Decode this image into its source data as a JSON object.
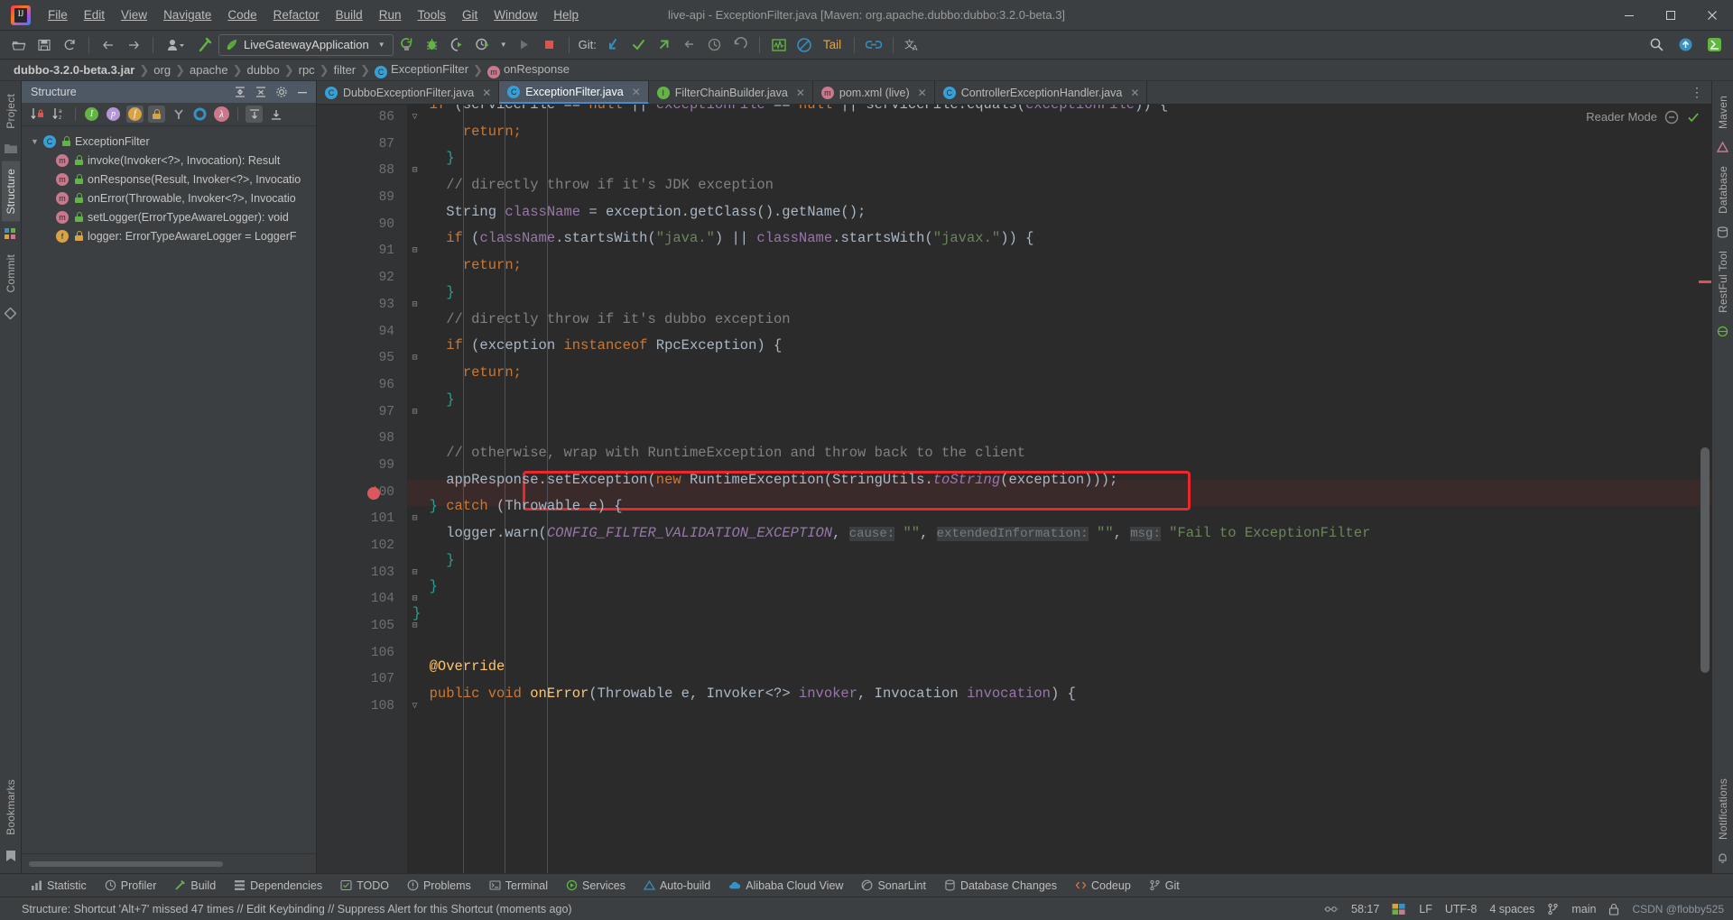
{
  "window": {
    "title": "live-api - ExceptionFilter.java [Maven: org.apache.dubbo:dubbo:3.2.0-beta.3]",
    "minimize": "—",
    "maximize": "❐",
    "close": "✕",
    "logo_text": "IJ"
  },
  "menubar": [
    {
      "name": "file",
      "label": "File"
    },
    {
      "name": "edit",
      "label": "Edit"
    },
    {
      "name": "view",
      "label": "View"
    },
    {
      "name": "navigate",
      "label": "Navigate"
    },
    {
      "name": "code",
      "label": "Code"
    },
    {
      "name": "refactor",
      "label": "Refactor"
    },
    {
      "name": "build",
      "label": "Build"
    },
    {
      "name": "run",
      "label": "Run"
    },
    {
      "name": "tools",
      "label": "Tools"
    },
    {
      "name": "git",
      "label": "Git"
    },
    {
      "name": "window",
      "label": "Window"
    },
    {
      "name": "help",
      "label": "Help"
    }
  ],
  "toolbar": {
    "open_icon": "open-folder-icon",
    "save_icon": "save-icon",
    "sync_icon": "refresh-icon",
    "back_icon": "back-arrow-icon",
    "forward_icon": "forward-arrow-icon",
    "profile_icon": "user-profile-icon",
    "build_icon": "hammer-icon",
    "run_config": "LiveGatewayApplication",
    "rerun_icon": "rerun-icon",
    "debug_icon": "debug-bug-icon",
    "coverage_icon": "run-with-coverage-icon",
    "profiler_icon": "profiler-clock-icon",
    "run_icon": "run-play-icon",
    "stop_icon": "stop-icon",
    "git_label": "Git:",
    "git_update": "update-project-icon",
    "git_commit": "commit-check-icon",
    "git_push": "push-arrow-icon",
    "git_revert": "rollback-icon",
    "git_history": "history-clock-icon",
    "undo_icon": "undo-icon",
    "monitor_icon": "monitor-graph-icon",
    "block_icon": "no-entry-icon",
    "tail_label": "Tail",
    "link_icon": "link-icon",
    "translate_icon": "translate-icon",
    "search_icon": "search-icon",
    "updates_icon": "updates-arrow-icon",
    "ide_icon": "ide-icon"
  },
  "breadcrumbs": [
    {
      "label": "dubbo-3.2.0-beta.3.jar",
      "icon": ""
    },
    {
      "label": "org",
      "icon": ""
    },
    {
      "label": "apache",
      "icon": ""
    },
    {
      "label": "dubbo",
      "icon": ""
    },
    {
      "label": "rpc",
      "icon": ""
    },
    {
      "label": "filter",
      "icon": ""
    },
    {
      "label": "ExceptionFilter",
      "icon": "class-icon"
    },
    {
      "label": "onResponse",
      "icon": "method-icon"
    }
  ],
  "left_rail": {
    "project_tab": "Project",
    "structure_tab": "Structure",
    "commit_tab": "Commit",
    "bookmarks_tab": "Bookmarks"
  },
  "right_rail": {
    "maven_tab": "Maven",
    "database_tab": "Database",
    "restful_tab": "RestFul Tool",
    "notifications_tab": "Notifications"
  },
  "structure": {
    "title": "Structure",
    "expand_icon": "expand-all-icon",
    "collapse_icon": "collapse-all-icon",
    "settings_icon": "gear-icon",
    "hide_icon": "hide-icon",
    "more_icon": "more-options-icon",
    "toolbar_icons": [
      "sort-by-visibility-icon",
      "sort-alphabetically-icon",
      "show-inherited-icon",
      "show-properties-icon",
      "show-fields-icon",
      "show-non-public-icon",
      "show-anonymous-icon",
      "show-interfaces-icon",
      "show-lambdas-icon",
      "scroll-from-source-icon",
      "scroll-to-source-icon"
    ],
    "tree": [
      {
        "label": "ExceptionFilter",
        "kind": "class",
        "indent": 0,
        "expanded": true,
        "lock": "green"
      },
      {
        "label": "invoke(Invoker<?>, Invocation): Result",
        "kind": "method",
        "indent": 1,
        "lock": "green"
      },
      {
        "label": "onResponse(Result, Invoker<?>, Invocatio",
        "kind": "method",
        "indent": 1,
        "lock": "green"
      },
      {
        "label": "onError(Throwable, Invoker<?>, Invocatio",
        "kind": "method",
        "indent": 1,
        "lock": "green"
      },
      {
        "label": "setLogger(ErrorTypeAwareLogger): void",
        "kind": "method",
        "indent": 1,
        "lock": "green"
      },
      {
        "label": "logger: ErrorTypeAwareLogger = LoggerF",
        "kind": "field",
        "indent": 1,
        "lock": "orange"
      }
    ]
  },
  "editor": {
    "tabs": [
      {
        "label": "DubboExceptionFilter.java",
        "icon": "class-icon",
        "active": false,
        "color": "#389fd6"
      },
      {
        "label": "ExceptionFilter.java",
        "icon": "class-icon",
        "active": true,
        "color": "#389fd6"
      },
      {
        "label": "FilterChainBuilder.java",
        "icon": "interface-icon",
        "active": false,
        "color": "#62b543"
      },
      {
        "label": "pom.xml (live)",
        "icon": "maven-icon",
        "active": false,
        "color": "#c9788e"
      },
      {
        "label": "ControllerExceptionHandler.java",
        "icon": "class-icon",
        "active": false,
        "color": "#389fd6"
      }
    ],
    "tab_close": "✕",
    "reader_mode": "Reader Mode",
    "inspection_icon": "inspections-widget-icon",
    "ok_icon": "no-problems-icon",
    "first_line_number": 86,
    "breakpoint_line": 100,
    "highlight_line": 100,
    "lines": [
      {
        "n": 86,
        "partial": true,
        "tokens": [
          {
            "t": "  ",
            "c": "plain"
          },
          {
            "t": "if ",
            "c": "kw"
          },
          {
            "t": "(serviceFile ",
            "c": "plain"
          },
          {
            "t": "== ",
            "c": "plain"
          },
          {
            "t": "null ",
            "c": "kw"
          },
          {
            "t": "|| ",
            "c": "plain"
          },
          {
            "t": "exceptionFile ",
            "c": "fld"
          },
          {
            "t": "== ",
            "c": "plain"
          },
          {
            "t": "null ",
            "c": "kw"
          },
          {
            "t": "|| ",
            "c": "plain"
          },
          {
            "t": "serviceFile",
            "c": "plain"
          },
          {
            "t": ".equals(",
            "c": "plain"
          },
          {
            "t": "exceptionFile",
            "c": "fld"
          },
          {
            "t": ")) {",
            "c": "plain"
          }
        ]
      },
      {
        "n": 87,
        "tokens": [
          {
            "t": "      ",
            "c": "plain"
          },
          {
            "t": "return;",
            "c": "kw"
          }
        ]
      },
      {
        "n": 88,
        "tokens": [
          {
            "t": "    ",
            "c": "plain"
          },
          {
            "t": "}",
            "c": "teal"
          }
        ]
      },
      {
        "n": 89,
        "tokens": [
          {
            "t": "    ",
            "c": "plain"
          },
          {
            "t": "// directly throw if it's JDK exception",
            "c": "cmt"
          }
        ]
      },
      {
        "n": 90,
        "tokens": [
          {
            "t": "    ",
            "c": "plain"
          },
          {
            "t": "String ",
            "c": "plain"
          },
          {
            "t": "className ",
            "c": "fld"
          },
          {
            "t": "= exception.getClass().getName();",
            "c": "plain"
          }
        ]
      },
      {
        "n": 91,
        "tokens": [
          {
            "t": "    ",
            "c": "plain"
          },
          {
            "t": "if ",
            "c": "kw"
          },
          {
            "t": "(",
            "c": "plain"
          },
          {
            "t": "className",
            "c": "fld"
          },
          {
            "t": ".startsWith(",
            "c": "plain"
          },
          {
            "t": "\"java.\"",
            "c": "str"
          },
          {
            "t": ") || ",
            "c": "plain"
          },
          {
            "t": "className",
            "c": "fld"
          },
          {
            "t": ".startsWith(",
            "c": "plain"
          },
          {
            "t": "\"javax.\"",
            "c": "str"
          },
          {
            "t": ")) {",
            "c": "plain"
          }
        ]
      },
      {
        "n": 92,
        "tokens": [
          {
            "t": "      ",
            "c": "plain"
          },
          {
            "t": "return;",
            "c": "kw"
          }
        ]
      },
      {
        "n": 93,
        "tokens": [
          {
            "t": "    ",
            "c": "plain"
          },
          {
            "t": "}",
            "c": "teal"
          }
        ]
      },
      {
        "n": 94,
        "tokens": [
          {
            "t": "    ",
            "c": "plain"
          },
          {
            "t": "// directly throw if it's dubbo exception",
            "c": "cmt"
          }
        ]
      },
      {
        "n": 95,
        "tokens": [
          {
            "t": "    ",
            "c": "plain"
          },
          {
            "t": "if ",
            "c": "kw"
          },
          {
            "t": "(exception ",
            "c": "plain"
          },
          {
            "t": "instanceof ",
            "c": "kw"
          },
          {
            "t": "RpcException) {",
            "c": "plain"
          }
        ]
      },
      {
        "n": 96,
        "tokens": [
          {
            "t": "      ",
            "c": "plain"
          },
          {
            "t": "return;",
            "c": "kw"
          }
        ]
      },
      {
        "n": 97,
        "tokens": [
          {
            "t": "    ",
            "c": "plain"
          },
          {
            "t": "}",
            "c": "teal"
          }
        ]
      },
      {
        "n": 98,
        "tokens": []
      },
      {
        "n": 99,
        "tokens": [
          {
            "t": "    ",
            "c": "plain"
          },
          {
            "t": "// otherwise, wrap with RuntimeException and throw back to the client",
            "c": "cmt"
          }
        ]
      },
      {
        "n": 100,
        "tokens": [
          {
            "t": "    ",
            "c": "plain"
          },
          {
            "t": "appResponse",
            "c": "plain"
          },
          {
            "t": ".setException(",
            "c": "plain"
          },
          {
            "t": "new ",
            "c": "kw"
          },
          {
            "t": "RuntimeException(StringUtils.",
            "c": "plain"
          },
          {
            "t": "toString",
            "c": "stat"
          },
          {
            "t": "(exception)));",
            "c": "plain"
          }
        ]
      },
      {
        "n": 101,
        "tokens": [
          {
            "t": "  ",
            "c": "plain"
          },
          {
            "t": "} ",
            "c": "teal"
          },
          {
            "t": "catch ",
            "c": "kw"
          },
          {
            "t": "(Throwable e) {",
            "c": "plain"
          }
        ]
      },
      {
        "n": 102,
        "tokens": [
          {
            "t": "    ",
            "c": "plain"
          },
          {
            "t": "logger",
            "c": "plain"
          },
          {
            "t": ".warn(",
            "c": "plain"
          },
          {
            "t": "CONFIG_FILTER_VALIDATION_EXCEPTION",
            "c": "stat"
          },
          {
            "t": ", ",
            "c": "plain"
          },
          {
            "t": "cause:",
            "c": "hint"
          },
          {
            "t": " ",
            "c": "plain"
          },
          {
            "t": "\"\"",
            "c": "str"
          },
          {
            "t": ", ",
            "c": "plain"
          },
          {
            "t": "extendedInformation:",
            "c": "hint"
          },
          {
            "t": " ",
            "c": "plain"
          },
          {
            "t": "\"\"",
            "c": "str"
          },
          {
            "t": ", ",
            "c": "plain"
          },
          {
            "t": "msg:",
            "c": "hint"
          },
          {
            "t": " ",
            "c": "plain"
          },
          {
            "t": "\"Fail to ExceptionFilter",
            "c": "str"
          }
        ]
      },
      {
        "n": 103,
        "tokens": [
          {
            "t": "    ",
            "c": "plain"
          },
          {
            "t": "}",
            "c": "teal"
          }
        ]
      },
      {
        "n": 104,
        "tokens": [
          {
            "t": "  ",
            "c": "plain"
          },
          {
            "t": "}",
            "c": "teal"
          }
        ]
      },
      {
        "n": 105,
        "tokens": [
          {
            "t": "",
            "c": "plain"
          },
          {
            "t": "}",
            "c": "teal"
          }
        ]
      },
      {
        "n": 106,
        "tokens": []
      },
      {
        "n": 107,
        "tokens": [
          {
            "t": "  ",
            "c": "plain"
          },
          {
            "t": "@Override",
            "c": "mth"
          }
        ]
      },
      {
        "n": 108,
        "tokens": [
          {
            "t": "  ",
            "c": "plain"
          },
          {
            "t": "public void ",
            "c": "kw"
          },
          {
            "t": "onError",
            "c": "mth"
          },
          {
            "t": "(",
            "c": "plain"
          },
          {
            "t": "Throwable e",
            "c": "plain"
          },
          {
            "t": ", Invoker<?> ",
            "c": "plain"
          },
          {
            "t": "invoker",
            "c": "fld"
          },
          {
            "t": ", Invocation ",
            "c": "plain"
          },
          {
            "t": "invocation",
            "c": "fld"
          },
          {
            "t": ") {",
            "c": "plain"
          }
        ]
      }
    ]
  },
  "bottom_tools": [
    {
      "label": "Statistic",
      "icon": "statistic-icon"
    },
    {
      "label": "Profiler",
      "icon": "profiler-icon"
    },
    {
      "label": "Build",
      "icon": "build-icon"
    },
    {
      "label": "Dependencies",
      "icon": "dependencies-icon"
    },
    {
      "label": "TODO",
      "icon": "todo-icon"
    },
    {
      "label": "Problems",
      "icon": "problems-icon"
    },
    {
      "label": "Terminal",
      "icon": "terminal-icon"
    },
    {
      "label": "Services",
      "icon": "services-icon"
    },
    {
      "label": "Auto-build",
      "icon": "autobuild-icon"
    },
    {
      "label": "Alibaba Cloud View",
      "icon": "alibaba-cloud-icon"
    },
    {
      "label": "SonarLint",
      "icon": "sonarlint-icon"
    },
    {
      "label": "Database Changes",
      "icon": "database-changes-icon"
    },
    {
      "label": "Codeup",
      "icon": "codeup-icon"
    },
    {
      "label": "Git",
      "icon": "git-branch-icon"
    }
  ],
  "statusbar": {
    "message": "Structure: Shortcut 'Alt+7' missed 47 times // Edit Keybinding // Suppress Alert for this Shortcut (moments ago)",
    "position": "58:17",
    "line_sep": "LF",
    "encoding": "UTF-8",
    "indent": "4 spaces",
    "branch": "main",
    "branch_icon": "git-branch-icon",
    "inspections_icon": "inspections-icon",
    "layout_icon": "layout-icon",
    "lock_icon": "read-only-lock-icon",
    "watermark": "CSDN @flobby525"
  }
}
